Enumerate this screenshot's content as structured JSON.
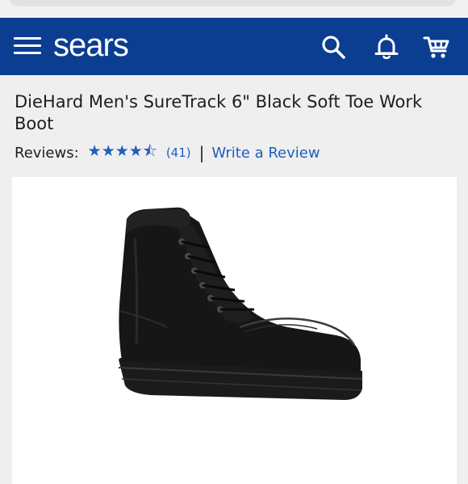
{
  "header": {
    "logo_text": "sears",
    "brand_color": "#0b3d91",
    "icons": [
      "menu-icon",
      "search-icon",
      "bell-icon",
      "cart-icon"
    ]
  },
  "product": {
    "title": "DieHard Men's SureTrack 6\" Black Soft Toe Work Boot",
    "reviews_label": "Reviews:",
    "rating_stars": 4.5,
    "stars_text": "★★★★⯪",
    "review_count": "(41)",
    "separator": "|",
    "write_review_label": "Write a Review",
    "link_color": "#1f5fbf"
  }
}
